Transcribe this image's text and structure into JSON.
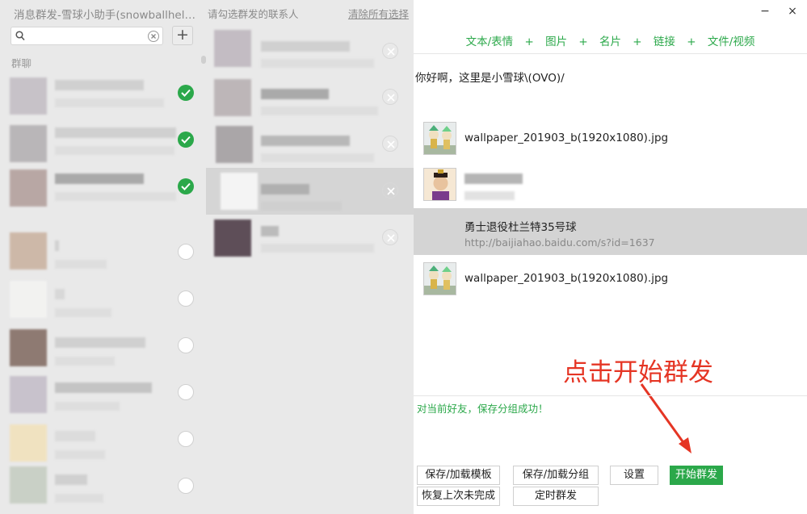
{
  "window": {
    "title": "消息群发-雪球小助手(snowballhel…"
  },
  "search": {
    "placeholder": "",
    "value": ""
  },
  "left": {
    "add_label": "+",
    "section_label": "群聊"
  },
  "contacts": [
    {
      "checked": true
    },
    {
      "checked": true
    },
    {
      "checked": true
    },
    {
      "checked": false
    },
    {
      "checked": false
    },
    {
      "checked": false
    },
    {
      "checked": false
    },
    {
      "checked": false
    },
    {
      "checked": false
    }
  ],
  "middle": {
    "title": "请勾选群发的联系人",
    "clear_all": "清除所有选择"
  },
  "selected": [
    {
      "highlighted": false
    },
    {
      "highlighted": false
    },
    {
      "highlighted": false
    },
    {
      "highlighted": true
    },
    {
      "highlighted": false
    }
  ],
  "controls": {
    "minimize": "−",
    "close": "×"
  },
  "toolbar": {
    "text_emoji": "文本/表情",
    "image": "图片",
    "card": "名片",
    "link": "链接",
    "file_video": "文件/视频",
    "separator": "+"
  },
  "message": {
    "text": "你好啊，这里是小雪球\\(OVO)/"
  },
  "attachments": {
    "file1": "wallpaper_201903_b(1920x1080).jpg",
    "link_title": "勇士退役杜兰特35号球",
    "link_url": "http://baijiahao.baidu.com/s?id=1637",
    "file2": "wallpaper_201903_b(1920x1080).jpg"
  },
  "annotation": "点击开始群发",
  "status": "对当前好友，保存分组成功！",
  "buttons": {
    "save_template": "保存/加载模板",
    "save_group": "保存/加载分组",
    "settings": "设置",
    "start": "开始群发",
    "resume": "恢复上次未完成",
    "schedule": "定时群发"
  },
  "colors": {
    "accent": "#2ba84a",
    "annotation": "#e53524",
    "selected_row": "#d4d4d4"
  }
}
